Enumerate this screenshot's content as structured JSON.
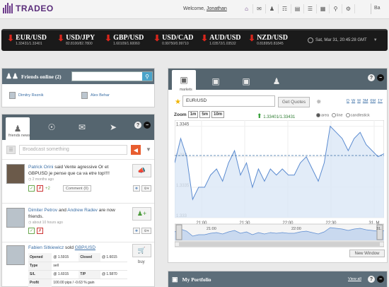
{
  "header": {
    "logo_text": "TRADEO",
    "welcome_text": "Welcome, ",
    "username": "Jonathan",
    "nav_icons": [
      "home-icon",
      "mail-icon",
      "people-icon",
      "network-icon",
      "wallet-icon",
      "ruler-icon",
      "grid-icon",
      "search-icon",
      "settings-icon"
    ],
    "right_fragment": "Ba"
  },
  "ticker": {
    "items": [
      {
        "pair": "EUR/USD",
        "price": "1.33431/1.33401",
        "direction": "down"
      },
      {
        "pair": "USD/JPY",
        "price": "82.8100/82.7800",
        "direction": "down"
      },
      {
        "pair": "GBP/USD",
        "price": "1.60109/1.60060",
        "direction": "down"
      },
      {
        "pair": "USD/CAD",
        "price": "0.99750/0.99710",
        "direction": "down"
      },
      {
        "pair": "AUD/USD",
        "price": "1.03572/1.03532",
        "direction": "down"
      },
      {
        "pair": "NZD/USD",
        "price": "0.81895/0.81845",
        "direction": "down"
      }
    ],
    "clock": "Sat, Mar 31, 20:45:28 GMT"
  },
  "friends_online": {
    "title": "Friends online (2)",
    "friends": [
      "Dimitry Reznik",
      "Alex Behar"
    ]
  },
  "friends_news": {
    "caption": "friends news",
    "broadcast_placeholder": "Broadcast something",
    "posts": [
      {
        "author": "Patrick Orini",
        "text": " said Vente agressive Or et GBPUSD je pense que ca va etre top!!!!",
        "time": "2 months ago",
        "likes": "+2",
        "comment_label": "Comment (0)"
      },
      {
        "author": "Dimiter Petrov",
        "and": " and ",
        "author2": "Andrew Radev",
        "text": " are now friends.",
        "time": "about 10 hours ago"
      },
      {
        "author": "Fabien Sitkiewicz",
        "text": " sold ",
        "symbol": "GBP/USD",
        "action_label": "buy",
        "trade": {
          "opened_k": "Opened",
          "opened_v": "@ 1.5915",
          "closed_k": "Closed",
          "closed_v": "@ 1.6015",
          "type_k": "Type",
          "type_v": "sell",
          "sl_k": "S/L",
          "sl_v": "@ 1.6015",
          "tp_k": "T/P",
          "tp_v": "@ 1.5870",
          "profit_k": "Profit",
          "profit_v": "100.00 pips / -0.63 % gain"
        }
      }
    ]
  },
  "markets": {
    "caption": "markets",
    "symbol": "EUR/USD",
    "get_quotes": "Get Quotes",
    "periods": [
      "D",
      "W",
      "M",
      "3M",
      "6M",
      "1Y"
    ],
    "zoom_label": "Zoom",
    "zoom_buttons": [
      "1m",
      "5m",
      "10m"
    ],
    "bid_ask": "1.33401/1.33431",
    "chart_types": [
      "area",
      "line",
      "candlestick"
    ],
    "selected_chart_type": "area",
    "new_window": "New Window"
  },
  "portfolio": {
    "title": "My Portfolio",
    "view_all": "View all"
  },
  "chart_data": {
    "type": "line",
    "title": "",
    "xlabel": "",
    "ylabel": "",
    "x_ticks": [
      "21:00",
      "21:30",
      "22:00",
      "22:30",
      "31. M"
    ],
    "y_ticks": [
      "1.333",
      "1.3335",
      "1.334",
      "1.3345"
    ],
    "ylim": [
      1.333,
      1.3346
    ],
    "reference_line": 1.33402,
    "series": [
      {
        "values": [
          1.3339,
          1.3343,
          1.334,
          1.3333,
          1.3335,
          1.3335,
          1.3337,
          1.3338,
          1.3336,
          1.3339,
          1.3341,
          1.3337,
          1.3339,
          1.3335,
          1.3338,
          1.3336,
          1.3338,
          1.3337,
          1.3338,
          1.3337,
          1.3337,
          1.3339,
          1.334,
          1.3338,
          1.3336,
          1.3339,
          1.3345,
          1.3344,
          1.3343,
          1.3341,
          1.3343,
          1.3344,
          1.3342,
          1.3341,
          1.334,
          1.33405
        ]
      }
    ],
    "navigator": {
      "x_ticks": [
        "21:00",
        "22:00",
        "31."
      ]
    },
    "grid": true,
    "colors": {
      "line": "#5b8bd0",
      "fill": "#dbe7f6",
      "reference": "#3a6ea5"
    }
  }
}
